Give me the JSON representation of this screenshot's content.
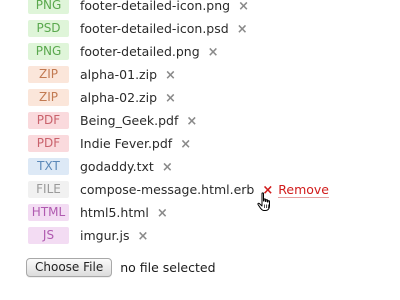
{
  "files": [
    {
      "ext": "PNG",
      "name": "footer-detailed-icon.png",
      "delete_icon": "×",
      "badge_bg": "#dff5d9",
      "badge_fg": "#5aa84e"
    },
    {
      "ext": "PSD",
      "name": "footer-detailed-icon.psd",
      "delete_icon": "×",
      "badge_bg": "#dff5d9",
      "badge_fg": "#5aa84e"
    },
    {
      "ext": "PNG",
      "name": "footer-detailed.png",
      "delete_icon": "×",
      "badge_bg": "#dff5d9",
      "badge_fg": "#5aa84e"
    },
    {
      "ext": "ZIP",
      "name": "alpha-01.zip",
      "delete_icon": "×",
      "badge_bg": "#fbe6da",
      "badge_fg": "#c27a52"
    },
    {
      "ext": "ZIP",
      "name": "alpha-02.zip",
      "delete_icon": "×",
      "badge_bg": "#fbe6da",
      "badge_fg": "#c27a52"
    },
    {
      "ext": "PDF",
      "name": "Being_Geek.pdf",
      "delete_icon": "×",
      "badge_bg": "#fadadd",
      "badge_fg": "#c9626c"
    },
    {
      "ext": "PDF",
      "name": "Indie Fever.pdf",
      "delete_icon": "×",
      "badge_bg": "#fadadd",
      "badge_fg": "#c9626c"
    },
    {
      "ext": "TXT",
      "name": "godaddy.txt",
      "delete_icon": "×",
      "badge_bg": "#dde9f6",
      "badge_fg": "#5b88b8"
    },
    {
      "ext": "FILE",
      "name": "compose-message.html.erb",
      "delete_icon": "×",
      "badge_bg": "#f1f1f1",
      "badge_fg": "#9a9a9a",
      "hovered": true,
      "remove_label": "Remove"
    },
    {
      "ext": "HTML",
      "name": "html5.html",
      "delete_icon": "×",
      "badge_bg": "#f3dcf3",
      "badge_fg": "#b05ab0"
    },
    {
      "ext": "JS",
      "name": "imgur.js",
      "delete_icon": "×",
      "badge_bg": "#f3dcf3",
      "badge_fg": "#b05ab0"
    }
  ],
  "uploader": {
    "button_label": "Choose File",
    "status_text": "no file selected"
  },
  "colors": {
    "remove_accent": "#d11b1b",
    "delete_icon_idle": "#8a8a8a"
  },
  "cursor": {
    "icon": "hand-pointer-icon"
  }
}
